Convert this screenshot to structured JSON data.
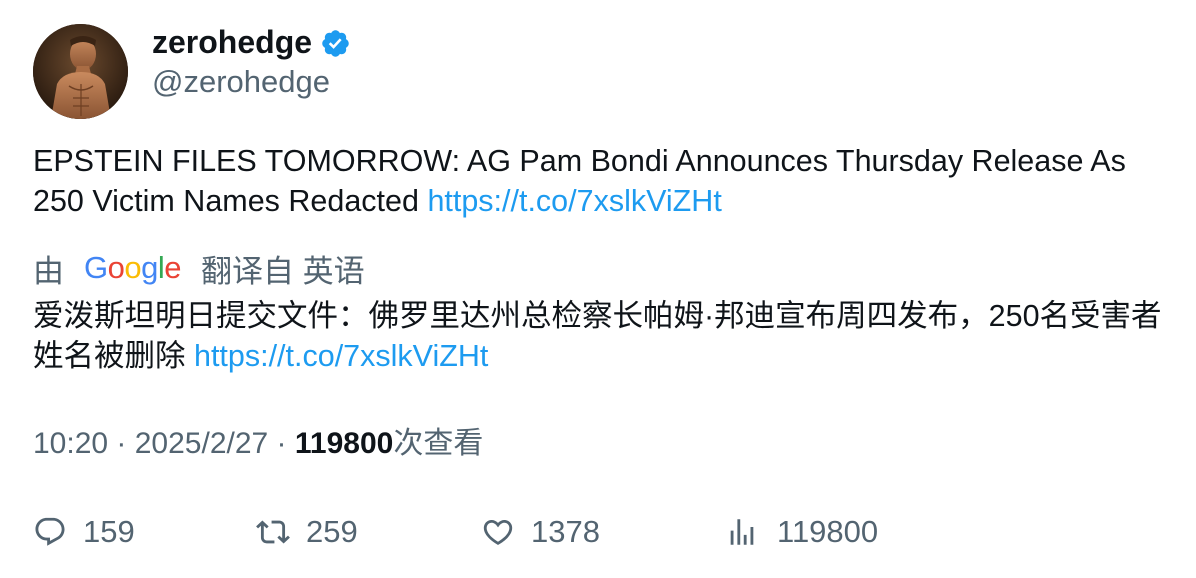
{
  "author": {
    "display_name": "zerohedge",
    "handle": "@zerohedge",
    "verified_icon": "verified-badge-icon",
    "avatar_icon": "avatar-image"
  },
  "tweet": {
    "text": "EPSTEIN FILES TOMORROW: AG Pam Bondi Announces Thursday Release As 250 Victim Names Redacted ",
    "link": "https://t.co/7xslkViZHt"
  },
  "translation": {
    "by_label": "由",
    "provider": {
      "letters": [
        "G",
        "o",
        "o",
        "g",
        "l",
        "e"
      ]
    },
    "from_label": "翻译自 英语",
    "text": "爱泼斯坦明日提交文件：佛罗里达州总检察长帕姆·邦迪宣布周四发布，250名受害者姓名被删除 ",
    "link": "https://t.co/7xslkViZHt"
  },
  "meta": {
    "time": "10:20",
    "separator": " · ",
    "date": "2025/2/27",
    "views_count": "119800",
    "views_label": "次查看"
  },
  "actions": {
    "reply": {
      "icon": "reply-icon",
      "count": "159"
    },
    "retweet": {
      "icon": "retweet-icon",
      "count": "259"
    },
    "like": {
      "icon": "heart-icon",
      "count": "1378"
    },
    "views": {
      "icon": "views-chart-icon",
      "count": "119800"
    }
  },
  "colors": {
    "link": "#1d9bf0",
    "secondary_text": "#536471",
    "primary_text": "#0f1419",
    "verified": "#1d9bf0"
  }
}
